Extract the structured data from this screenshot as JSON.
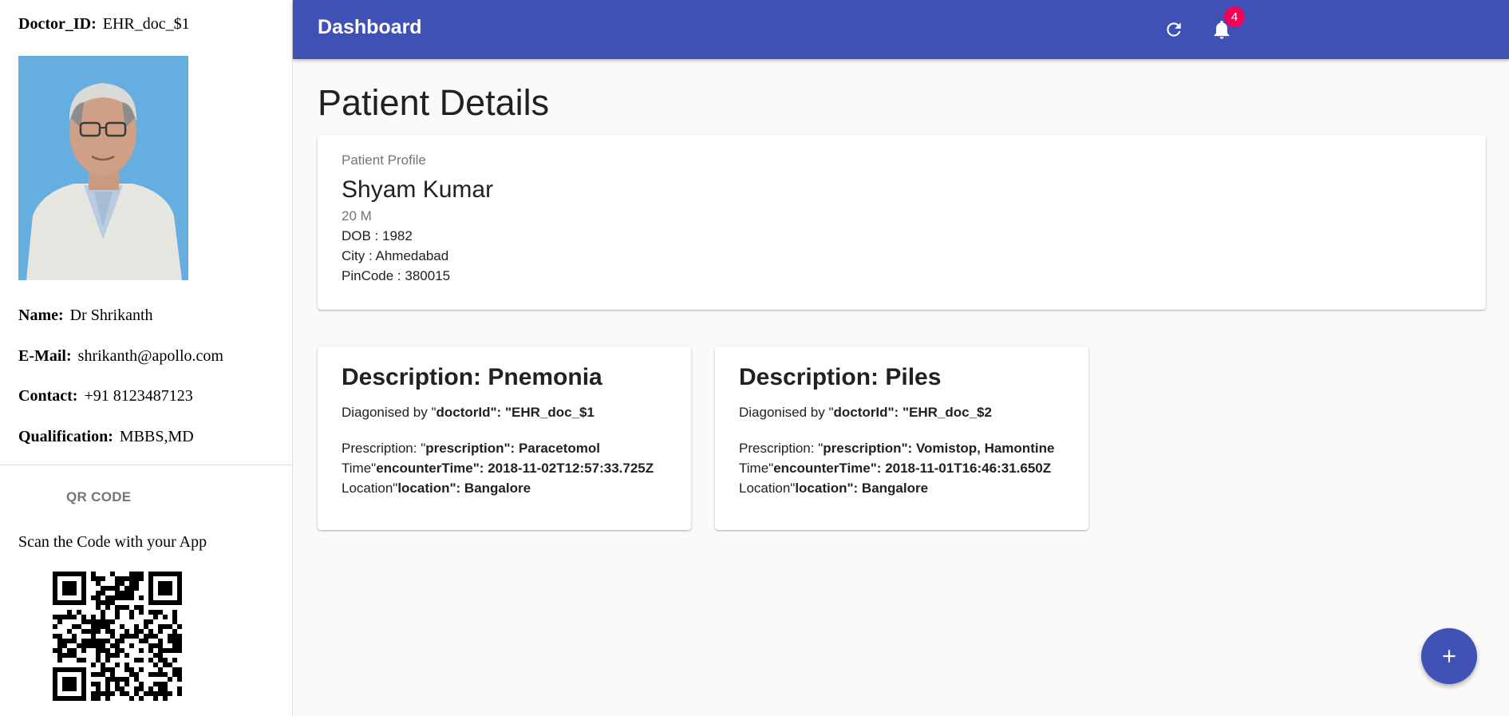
{
  "doctor": {
    "id_label": "Doctor_ID:",
    "id_value": "EHR_doc_$1",
    "name_label": "Name:",
    "name_value": "Dr Shrikanth",
    "email_label": "E-Mail:",
    "email_value": "shrikanth@apollo.com",
    "contact_label": "Contact:",
    "contact_value": "+91 8123487123",
    "qualification_label": "Qualification:",
    "qualification_value": "MBBS,MD"
  },
  "qr": {
    "tab_label": "QR CODE",
    "instruction": "Scan the Code with your App"
  },
  "appbar": {
    "title": "Dashboard",
    "notification_count": "4",
    "color": "#3f51b5",
    "icons": [
      "refresh-icon",
      "bell-icon"
    ]
  },
  "page": {
    "title": "Patient Details"
  },
  "patient": {
    "profile_label": "Patient Profile",
    "name": "Shyam Kumar",
    "age_sex": "20 M",
    "dob": "DOB : 1982",
    "city": "City : Ahmedabad",
    "pincode": "PinCode : 380015"
  },
  "records": [
    {
      "title": "Description: Pnemonia",
      "diag_prefix": "Diagonised by \"",
      "diag_key": "doctorId",
      "diag_value": "\": \"EHR_doc_$1",
      "rx_prefix": "Prescription: \"",
      "rx_key": "prescription",
      "rx_value": "\": Paracetomol",
      "time_prefix": "Time\"",
      "time_key": "encounterTime",
      "time_value": "\": 2018-11-02T12:57:33.725Z",
      "loc_prefix": "Location\"",
      "loc_key": "location",
      "loc_value": "\": Bangalore"
    },
    {
      "title": "Description: Piles",
      "diag_prefix": "Diagonised by \"",
      "diag_key": "doctorId",
      "diag_value": "\": \"EHR_doc_$2",
      "rx_prefix": "Prescription: \"",
      "rx_key": "prescription",
      "rx_value": "\": Vomistop, Hamontine",
      "time_prefix": "Time\"",
      "time_key": "encounterTime",
      "time_value": "\": 2018-11-01T16:46:31.650Z",
      "loc_prefix": "Location\"",
      "loc_key": "location",
      "loc_value": "\": Bangalore"
    }
  ],
  "fab": {
    "icon": "plus-icon",
    "color": "#3f51b5"
  }
}
